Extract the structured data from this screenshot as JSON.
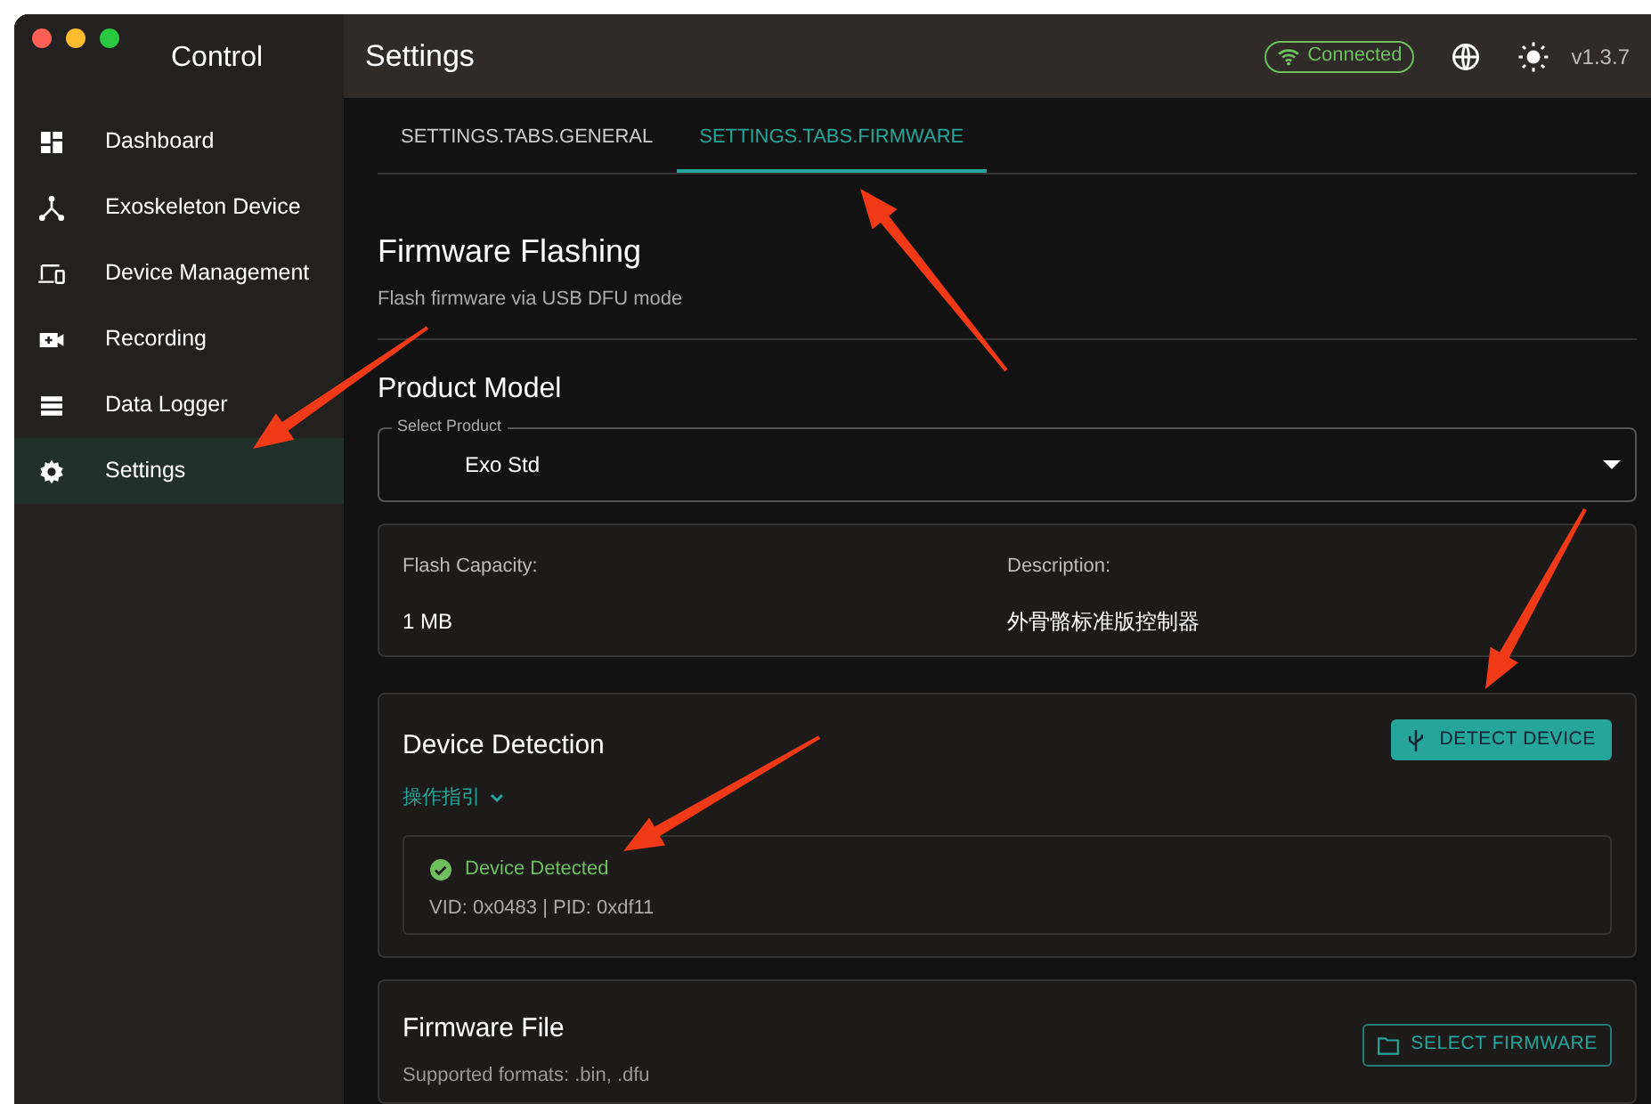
{
  "window": {
    "title": "Control",
    "traffic_lights": [
      {
        "color": "#fe5f57"
      },
      {
        "color": "#febc2e"
      },
      {
        "color": "#28c840"
      }
    ]
  },
  "sidebar": {
    "items": [
      {
        "label": "Dashboard",
        "kind": "dashboard",
        "selected": false
      },
      {
        "label": "Exoskeleton Device",
        "kind": "hub",
        "selected": false
      },
      {
        "label": "Device Management",
        "kind": "devices",
        "selected": false
      },
      {
        "label": "Recording",
        "kind": "video",
        "selected": false
      },
      {
        "label": "Data Logger",
        "kind": "list",
        "selected": false
      },
      {
        "label": "Settings",
        "kind": "gear",
        "selected": true
      }
    ]
  },
  "header": {
    "title": "Settings",
    "status": {
      "label": "Connected",
      "connected": true
    },
    "version": "v1.3.7"
  },
  "tabs": [
    {
      "label": "SETTINGS.TABS.GENERAL",
      "selected": false
    },
    {
      "label": "SETTINGS.TABS.FIRMWARE",
      "selected": true
    }
  ],
  "firmware_flashing": {
    "title": "Firmware Flashing",
    "subtitle": "Flash firmware via USB DFU mode"
  },
  "product_model": {
    "title": "Product Model",
    "select": {
      "label": "Select Product",
      "value": "Exo Std"
    },
    "info": [
      {
        "label": "Flash Capacity:",
        "value": "1 MB"
      },
      {
        "label": "Description:",
        "value": "外骨骼标准版控制器"
      }
    ]
  },
  "device_detection": {
    "title": "Device Detection",
    "button": "DETECT DEVICE",
    "guide": {
      "label": "操作指引",
      "expanded": false
    },
    "result": {
      "detected": true,
      "status": "Device Detected",
      "ids": "VID: 0x0483 | PID: 0xdf11"
    }
  },
  "firmware_file": {
    "title": "Firmware File",
    "subtitle": "Supported formats: .bin, .dfu",
    "button": "SELECT FIRMWARE"
  },
  "annotation_arrows": [
    {
      "kind": "arrow"
    },
    {
      "kind": "arrow"
    },
    {
      "kind": "arrow"
    },
    {
      "kind": "arrow"
    }
  ]
}
